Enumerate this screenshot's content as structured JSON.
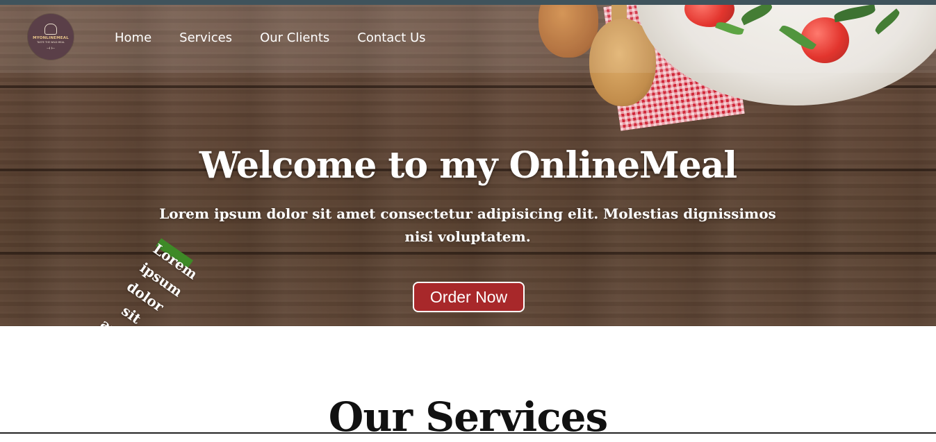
{
  "brand": {
    "logo_text": "MYONLINEMEAL",
    "logo_tagline": "TASTE THE WILD MEAL"
  },
  "nav": {
    "items": [
      {
        "label": "Home"
      },
      {
        "label": "Services"
      },
      {
        "label": "Our Clients"
      },
      {
        "label": "Contact Us"
      }
    ]
  },
  "hero": {
    "title": "Welcome to my OnlineMeal",
    "line1": "Lorem ipsum dolor sit amet consectetur adipisicing elit. Molestias dignissimos nisi voluptatem.",
    "line2": "Lorem ipsum dolor sit amet consectetur adipisicing elit..",
    "button_label": "Order Now"
  },
  "services": {
    "title": "Our Services"
  },
  "colors": {
    "top_strip": "#3f535c",
    "button_bg": "#a8282a",
    "logo_bg": "#5a3f48",
    "wood": "#5d4333"
  }
}
